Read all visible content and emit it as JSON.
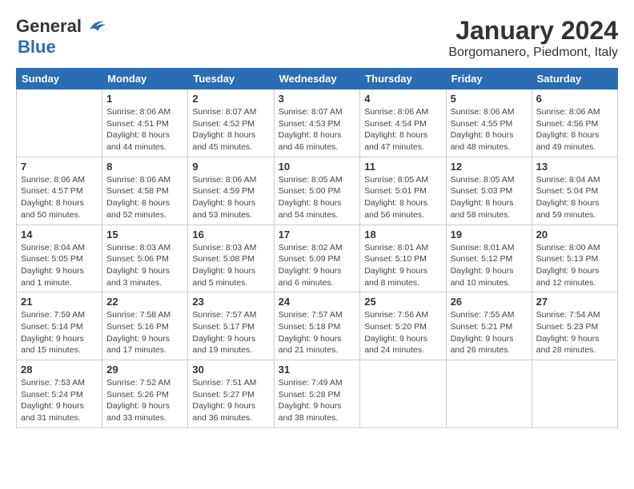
{
  "logo": {
    "line1": "General",
    "line2": "Blue",
    "bird_symbol": "▲"
  },
  "title": "January 2024",
  "subtitle": "Borgomanero, Piedmont, Italy",
  "days_of_week": [
    "Sunday",
    "Monday",
    "Tuesday",
    "Wednesday",
    "Thursday",
    "Friday",
    "Saturday"
  ],
  "weeks": [
    [
      {
        "day": "",
        "sunrise": "",
        "sunset": "",
        "daylight": ""
      },
      {
        "day": "1",
        "sunrise": "Sunrise: 8:06 AM",
        "sunset": "Sunset: 4:51 PM",
        "daylight": "Daylight: 8 hours and 44 minutes."
      },
      {
        "day": "2",
        "sunrise": "Sunrise: 8:07 AM",
        "sunset": "Sunset: 4:52 PM",
        "daylight": "Daylight: 8 hours and 45 minutes."
      },
      {
        "day": "3",
        "sunrise": "Sunrise: 8:07 AM",
        "sunset": "Sunset: 4:53 PM",
        "daylight": "Daylight: 8 hours and 46 minutes."
      },
      {
        "day": "4",
        "sunrise": "Sunrise: 8:06 AM",
        "sunset": "Sunset: 4:54 PM",
        "daylight": "Daylight: 8 hours and 47 minutes."
      },
      {
        "day": "5",
        "sunrise": "Sunrise: 8:06 AM",
        "sunset": "Sunset: 4:55 PM",
        "daylight": "Daylight: 8 hours and 48 minutes."
      },
      {
        "day": "6",
        "sunrise": "Sunrise: 8:06 AM",
        "sunset": "Sunset: 4:56 PM",
        "daylight": "Daylight: 8 hours and 49 minutes."
      }
    ],
    [
      {
        "day": "7",
        "sunrise": "Sunrise: 8:06 AM",
        "sunset": "Sunset: 4:57 PM",
        "daylight": "Daylight: 8 hours and 50 minutes."
      },
      {
        "day": "8",
        "sunrise": "Sunrise: 8:06 AM",
        "sunset": "Sunset: 4:58 PM",
        "daylight": "Daylight: 8 hours and 52 minutes."
      },
      {
        "day": "9",
        "sunrise": "Sunrise: 8:06 AM",
        "sunset": "Sunset: 4:59 PM",
        "daylight": "Daylight: 8 hours and 53 minutes."
      },
      {
        "day": "10",
        "sunrise": "Sunrise: 8:05 AM",
        "sunset": "Sunset: 5:00 PM",
        "daylight": "Daylight: 8 hours and 54 minutes."
      },
      {
        "day": "11",
        "sunrise": "Sunrise: 8:05 AM",
        "sunset": "Sunset: 5:01 PM",
        "daylight": "Daylight: 8 hours and 56 minutes."
      },
      {
        "day": "12",
        "sunrise": "Sunrise: 8:05 AM",
        "sunset": "Sunset: 5:03 PM",
        "daylight": "Daylight: 8 hours and 58 minutes."
      },
      {
        "day": "13",
        "sunrise": "Sunrise: 8:04 AM",
        "sunset": "Sunset: 5:04 PM",
        "daylight": "Daylight: 8 hours and 59 minutes."
      }
    ],
    [
      {
        "day": "14",
        "sunrise": "Sunrise: 8:04 AM",
        "sunset": "Sunset: 5:05 PM",
        "daylight": "Daylight: 9 hours and 1 minute."
      },
      {
        "day": "15",
        "sunrise": "Sunrise: 8:03 AM",
        "sunset": "Sunset: 5:06 PM",
        "daylight": "Daylight: 9 hours and 3 minutes."
      },
      {
        "day": "16",
        "sunrise": "Sunrise: 8:03 AM",
        "sunset": "Sunset: 5:08 PM",
        "daylight": "Daylight: 9 hours and 5 minutes."
      },
      {
        "day": "17",
        "sunrise": "Sunrise: 8:02 AM",
        "sunset": "Sunset: 5:09 PM",
        "daylight": "Daylight: 9 hours and 6 minutes."
      },
      {
        "day": "18",
        "sunrise": "Sunrise: 8:01 AM",
        "sunset": "Sunset: 5:10 PM",
        "daylight": "Daylight: 9 hours and 8 minutes."
      },
      {
        "day": "19",
        "sunrise": "Sunrise: 8:01 AM",
        "sunset": "Sunset: 5:12 PM",
        "daylight": "Daylight: 9 hours and 10 minutes."
      },
      {
        "day": "20",
        "sunrise": "Sunrise: 8:00 AM",
        "sunset": "Sunset: 5:13 PM",
        "daylight": "Daylight: 9 hours and 12 minutes."
      }
    ],
    [
      {
        "day": "21",
        "sunrise": "Sunrise: 7:59 AM",
        "sunset": "Sunset: 5:14 PM",
        "daylight": "Daylight: 9 hours and 15 minutes."
      },
      {
        "day": "22",
        "sunrise": "Sunrise: 7:58 AM",
        "sunset": "Sunset: 5:16 PM",
        "daylight": "Daylight: 9 hours and 17 minutes."
      },
      {
        "day": "23",
        "sunrise": "Sunrise: 7:57 AM",
        "sunset": "Sunset: 5:17 PM",
        "daylight": "Daylight: 9 hours and 19 minutes."
      },
      {
        "day": "24",
        "sunrise": "Sunrise: 7:57 AM",
        "sunset": "Sunset: 5:18 PM",
        "daylight": "Daylight: 9 hours and 21 minutes."
      },
      {
        "day": "25",
        "sunrise": "Sunrise: 7:56 AM",
        "sunset": "Sunset: 5:20 PM",
        "daylight": "Daylight: 9 hours and 24 minutes."
      },
      {
        "day": "26",
        "sunrise": "Sunrise: 7:55 AM",
        "sunset": "Sunset: 5:21 PM",
        "daylight": "Daylight: 9 hours and 26 minutes."
      },
      {
        "day": "27",
        "sunrise": "Sunrise: 7:54 AM",
        "sunset": "Sunset: 5:23 PM",
        "daylight": "Daylight: 9 hours and 28 minutes."
      }
    ],
    [
      {
        "day": "28",
        "sunrise": "Sunrise: 7:53 AM",
        "sunset": "Sunset: 5:24 PM",
        "daylight": "Daylight: 9 hours and 31 minutes."
      },
      {
        "day": "29",
        "sunrise": "Sunrise: 7:52 AM",
        "sunset": "Sunset: 5:26 PM",
        "daylight": "Daylight: 9 hours and 33 minutes."
      },
      {
        "day": "30",
        "sunrise": "Sunrise: 7:51 AM",
        "sunset": "Sunset: 5:27 PM",
        "daylight": "Daylight: 9 hours and 36 minutes."
      },
      {
        "day": "31",
        "sunrise": "Sunrise: 7:49 AM",
        "sunset": "Sunset: 5:28 PM",
        "daylight": "Daylight: 9 hours and 38 minutes."
      },
      {
        "day": "",
        "sunrise": "",
        "sunset": "",
        "daylight": ""
      },
      {
        "day": "",
        "sunrise": "",
        "sunset": "",
        "daylight": ""
      },
      {
        "day": "",
        "sunrise": "",
        "sunset": "",
        "daylight": ""
      }
    ]
  ]
}
